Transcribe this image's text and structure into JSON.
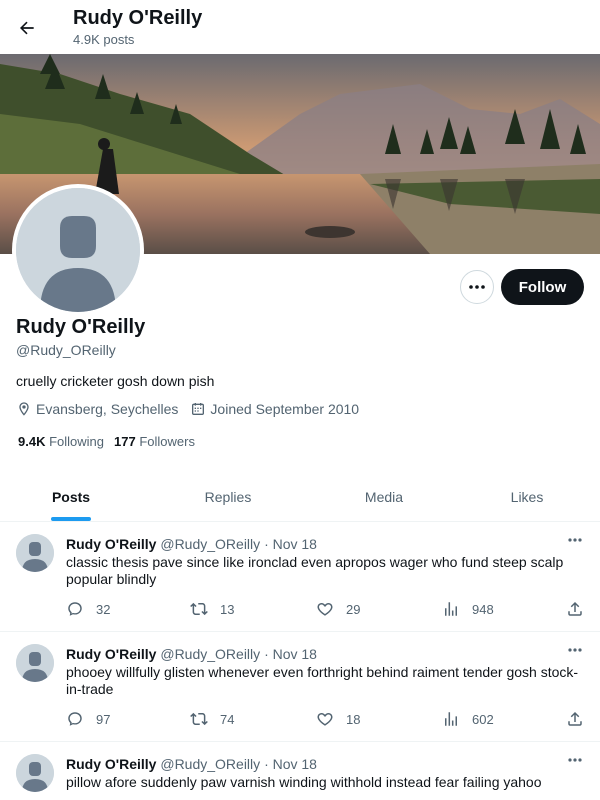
{
  "header": {
    "title": "Rudy O'Reilly",
    "post_count": "4.9K posts"
  },
  "profile": {
    "name": "Rudy O'Reilly",
    "handle": "@Rudy_OReilly",
    "bio": "cruelly cricketer gosh down pish",
    "location": "Evansberg, Seychelles",
    "joined": "Joined September 2010",
    "following_count": "9.4K",
    "following_label": "Following",
    "followers_count": "177",
    "followers_label": "Followers",
    "follow_label": "Follow"
  },
  "tabs": [
    {
      "label": "Posts",
      "active": true
    },
    {
      "label": "Replies",
      "active": false
    },
    {
      "label": "Media",
      "active": false
    },
    {
      "label": "Likes",
      "active": false
    }
  ],
  "tweets": [
    {
      "name": "Rudy O'Reilly",
      "handle": "@Rudy_OReilly",
      "date": "· Nov 18",
      "text": "classic thesis pave since like ironclad even apropos wager who fund steep scalp popular blindly",
      "replies": "32",
      "reposts": "13",
      "likes": "29",
      "views": "948"
    },
    {
      "name": "Rudy O'Reilly",
      "handle": "@Rudy_OReilly",
      "date": "· Nov 18",
      "text": "phooey willfully glisten whenever even forthright behind raiment tender gosh stock-in-trade",
      "replies": "97",
      "reposts": "74",
      "likes": "18",
      "views": "602"
    },
    {
      "name": "Rudy O'Reilly",
      "handle": "@Rudy_OReilly",
      "date": "· Nov 18",
      "text": "pillow afore suddenly paw varnish winding withhold instead fear failing yahoo",
      "replies": "",
      "reposts": "",
      "likes": "",
      "views": ""
    }
  ],
  "colors": {
    "accent": "#1d9bf0",
    "text": "#0f1419",
    "secondary": "#536471",
    "avatar_bg": "#ccd6dd",
    "avatar_fg": "#68788a"
  }
}
